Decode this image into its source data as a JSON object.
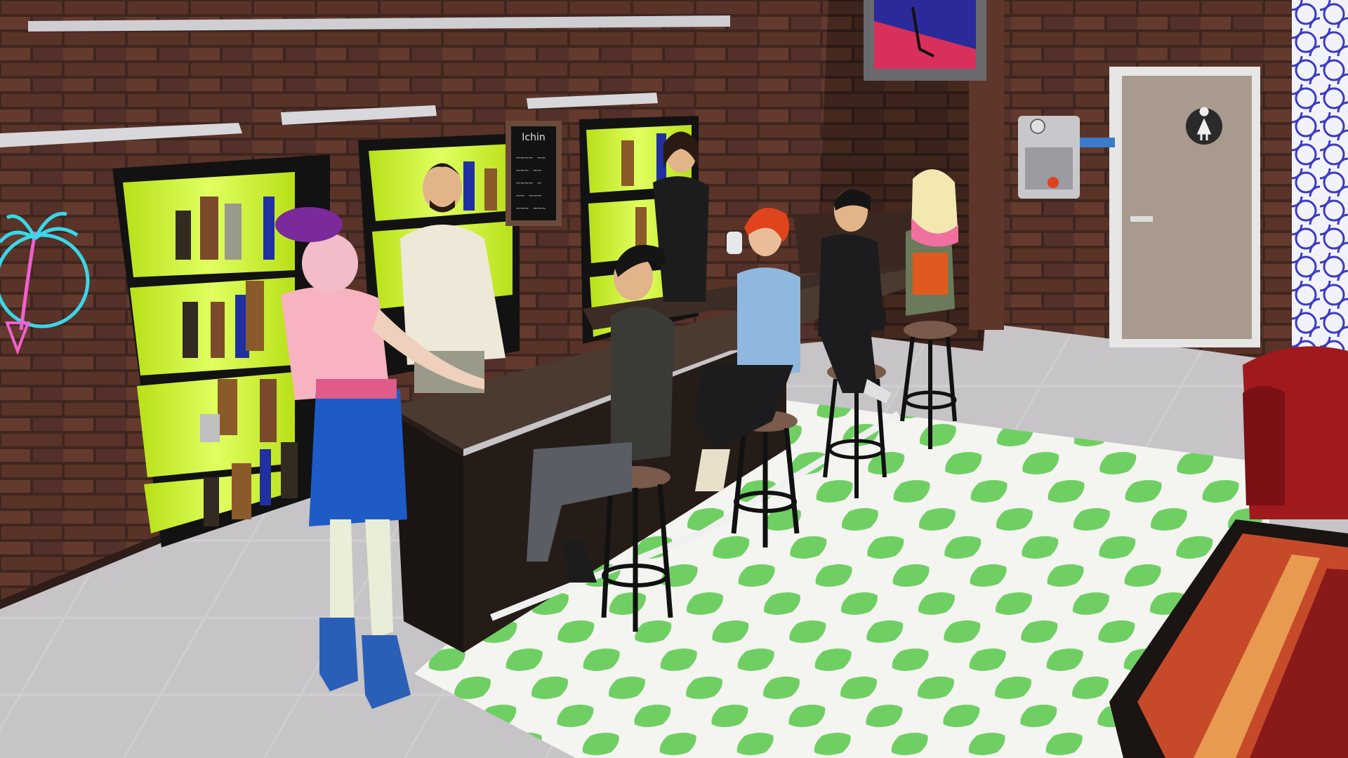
{
  "scene": {
    "setting": "bar-lounge-interior",
    "menu_board": {
      "title": "Ichin",
      "lines": [
        "~~~~ ~~",
        "~~~ ~~",
        "~~~~ ~",
        "~~ ~~~",
        "~~~ ~~~"
      ]
    },
    "restroom_door": {
      "sign_icon": "female-restroom-icon"
    },
    "colors": {
      "brick_wall": "#5a3328",
      "floor_tile": "#c9c7c8",
      "rug_green": "#6fcf63",
      "rug_white": "#f4f4f0",
      "shelf_glow": "#c8f020",
      "bar_counter": "#2c2420",
      "neon_sign": "#38d8e8",
      "door": "#a89a8c",
      "armchair": "#a0191c"
    },
    "characters": [
      {
        "id": "sim-purple-beret",
        "role": "customer"
      },
      {
        "id": "sim-bartender-white-shirt",
        "role": "bartender"
      },
      {
        "id": "sim-bartender-black-outfit",
        "role": "bartender"
      },
      {
        "id": "sim-dark-jacket-seated",
        "role": "customer"
      },
      {
        "id": "sim-red-hair-denim",
        "role": "customer"
      },
      {
        "id": "sim-black-suit-seated",
        "role": "customer"
      },
      {
        "id": "sim-pink-blonde-hair",
        "role": "customer"
      }
    ]
  }
}
